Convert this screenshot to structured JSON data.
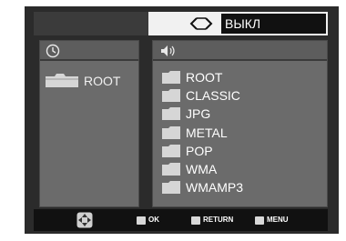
{
  "header": {
    "repeat_value": "ВЫКЛ"
  },
  "left_panel": {
    "tree_root_label": "ROOT"
  },
  "right_panel": {
    "folders": [
      {
        "label": "ROOT"
      },
      {
        "label": "CLASSIC"
      },
      {
        "label": "JPG"
      },
      {
        "label": "METAL"
      },
      {
        "label": "POP"
      },
      {
        "label": "WMA"
      },
      {
        "label": "WMAMP3"
      }
    ]
  },
  "footer": {
    "ok_label": "OK",
    "return_label": "RETURN",
    "menu_label": "MENU"
  },
  "colors": {
    "background": "#2b2b2b",
    "panel": "#6b6b6b",
    "folder": "#d6d6d6"
  },
  "icons": [
    "repeat-icon",
    "clock-icon",
    "speaker-icon",
    "folder-icon",
    "navigation-arrows-icon",
    "ok-key-icon",
    "return-key-icon",
    "menu-key-icon"
  ]
}
